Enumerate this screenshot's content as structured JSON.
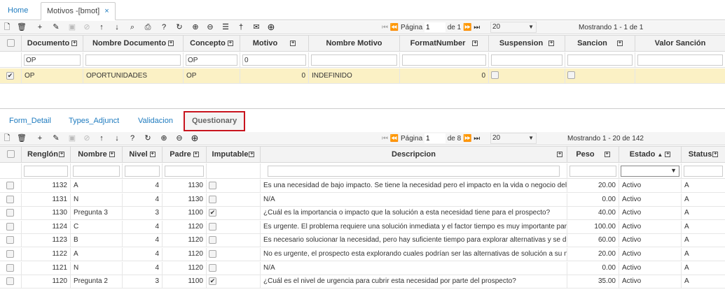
{
  "top_tabs": {
    "home": "Home",
    "active": "Motivos -[bmot]",
    "close": "×"
  },
  "toolbar1": {
    "pagina_label": "Página",
    "page_value": "1",
    "of_label": "de 1",
    "page_size": "20",
    "mostrando": "Mostrando 1 - 1 de 1"
  },
  "grid1": {
    "headers": [
      "Documento",
      "Nombre Documento",
      "Concepto",
      "Motivo",
      "Nombre Motivo",
      "FormatNumber",
      "Suspension",
      "Sancion",
      "Valor Sanción"
    ],
    "filters": {
      "documento": "OP",
      "concepto": "OP",
      "motivo": "0"
    },
    "row": {
      "documento": "OP",
      "nombre_documento": "OPORTUNIDADES",
      "concepto": "OP",
      "motivo": "0",
      "nombre_motivo": "INDEFINIDO",
      "format_number": "0",
      "checked": true,
      "suspension": false,
      "sancion": false
    }
  },
  "sub_tabs": [
    "Form_Detail",
    "Types_Adjunct",
    "Validacion",
    "Questionary"
  ],
  "toolbar2": {
    "pagina_label": "Página",
    "page_value": "1",
    "of_label": "de 8",
    "page_size": "20",
    "mostrando": "Mostrando 1 - 20 de 142"
  },
  "grid2": {
    "headers": [
      "Renglón",
      "Nombre",
      "Nivel",
      "Padre",
      "Imputable",
      "Descripcion",
      "Peso",
      "Estado",
      "Status"
    ],
    "rows": [
      {
        "renglon": "1132",
        "nombre": "A",
        "nivel": "4",
        "padre": "1130",
        "imputable": false,
        "descripcion": "Es una necesidad de bajo impacto. Se tiene la necesidad pero el impacto en la vida o negocio del",
        "peso": "20.00",
        "estado": "Activo",
        "status": "A"
      },
      {
        "renglon": "1131",
        "nombre": "N",
        "nivel": "4",
        "padre": "1130",
        "imputable": false,
        "descripcion": "N/A",
        "peso": "0.00",
        "estado": "Activo",
        "status": "A"
      },
      {
        "renglon": "1130",
        "nombre": "Pregunta 3",
        "nivel": "3",
        "padre": "1100",
        "imputable": true,
        "descripcion": "¿Cuál es la importancia o impacto que la solución a esta necesidad tiene para el prospecto?",
        "peso": "40.00",
        "estado": "Activo",
        "status": "A"
      },
      {
        "renglon": "1124",
        "nombre": "C",
        "nivel": "4",
        "padre": "1120",
        "imputable": false,
        "descripcion": "Es urgente. El problema requiere una solución inmediata y el factor tiempo es muy importante par",
        "peso": "100.00",
        "estado": "Activo",
        "status": "A"
      },
      {
        "renglon": "1123",
        "nombre": "B",
        "nivel": "4",
        "padre": "1120",
        "imputable": false,
        "descripcion": "Es necesario solucionar la necesidad, pero hay suficiente tiempo para explorar alternativas y se d",
        "peso": "60.00",
        "estado": "Activo",
        "status": "A"
      },
      {
        "renglon": "1122",
        "nombre": "A",
        "nivel": "4",
        "padre": "1120",
        "imputable": false,
        "descripcion": "No es urgente, el prospecto esta explorando cuales podrían ser las alternativas de solución a su n",
        "peso": "20.00",
        "estado": "Activo",
        "status": "A"
      },
      {
        "renglon": "1121",
        "nombre": "N",
        "nivel": "4",
        "padre": "1120",
        "imputable": false,
        "descripcion": "N/A",
        "peso": "0.00",
        "estado": "Activo",
        "status": "A"
      },
      {
        "renglon": "1120",
        "nombre": "Pregunta 2",
        "nivel": "3",
        "padre": "1100",
        "imputable": true,
        "descripcion": "¿Cuál es el nivel de urgencia para cubrir esta necesidad por parte del prospecto?",
        "peso": "35.00",
        "estado": "Activo",
        "status": "A"
      }
    ]
  }
}
